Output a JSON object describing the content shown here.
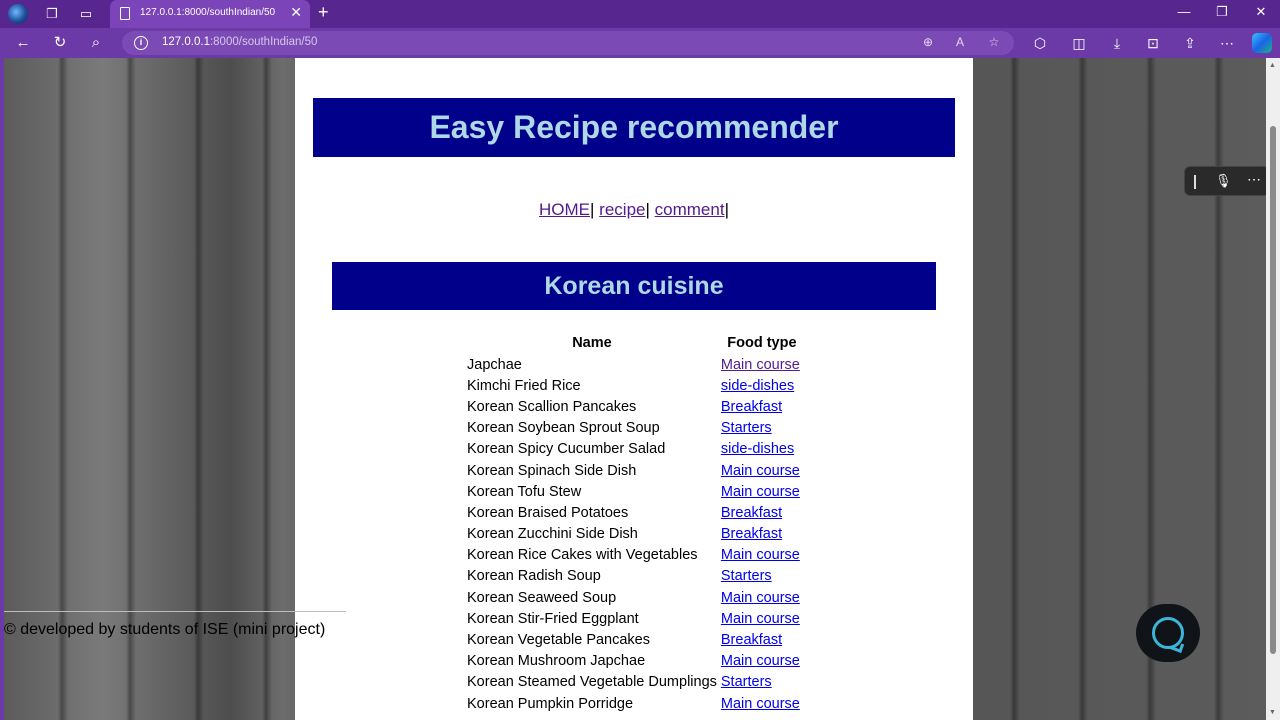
{
  "browser": {
    "tab_title": "127.0.0.1:8000/southIndian/50",
    "url_host": "127.0.0.1",
    "url_path": ":8000/southIndian/50"
  },
  "page": {
    "title": "Easy Recipe recommender",
    "menu": [
      {
        "label": "HOME"
      },
      {
        "label": "recipe"
      },
      {
        "label": "comment"
      }
    ],
    "menu_separator": "|",
    "section_title": "Korean cuisine",
    "table": {
      "headers": [
        "Name",
        "Food type"
      ],
      "rows": [
        {
          "name": "Japchae",
          "type": "Main course"
        },
        {
          "name": "Kimchi Fried Rice",
          "type": "side-dishes"
        },
        {
          "name": "Korean Scallion Pancakes",
          "type": "Breakfast"
        },
        {
          "name": "Korean Soybean Sprout Soup",
          "type": "Starters"
        },
        {
          "name": "Korean Spicy Cucumber Salad",
          "type": "side-dishes"
        },
        {
          "name": "Korean Spinach Side Dish",
          "type": "Main course"
        },
        {
          "name": "Korean Tofu Stew",
          "type": "Main course"
        },
        {
          "name": "Korean Braised Potatoes",
          "type": "Breakfast"
        },
        {
          "name": "Korean Zucchini Side Dish",
          "type": "Breakfast"
        },
        {
          "name": "Korean Rice Cakes with Vegetables",
          "type": "Main course"
        },
        {
          "name": "Korean Radish Soup",
          "type": "Starters"
        },
        {
          "name": "Korean Seaweed Soup",
          "type": "Main course"
        },
        {
          "name": "Korean Stir-Fried Eggplant",
          "type": "Main course"
        },
        {
          "name": "Korean Vegetable Pancakes",
          "type": "Breakfast"
        },
        {
          "name": "Korean Mushroom Japchae",
          "type": "Main course"
        },
        {
          "name": "Korean Steamed Vegetable Dumplings",
          "type": "Starters"
        },
        {
          "name": "Korean Pumpkin Porridge",
          "type": "Main course"
        }
      ]
    },
    "footer": "© developed by students of ISE (mini project)"
  },
  "colors": {
    "banner_bg": "#00008b",
    "banner_text": "#add8e6",
    "link": "#0000ee",
    "visited_link": "#551a8b",
    "browser_chrome": "#57268e"
  }
}
